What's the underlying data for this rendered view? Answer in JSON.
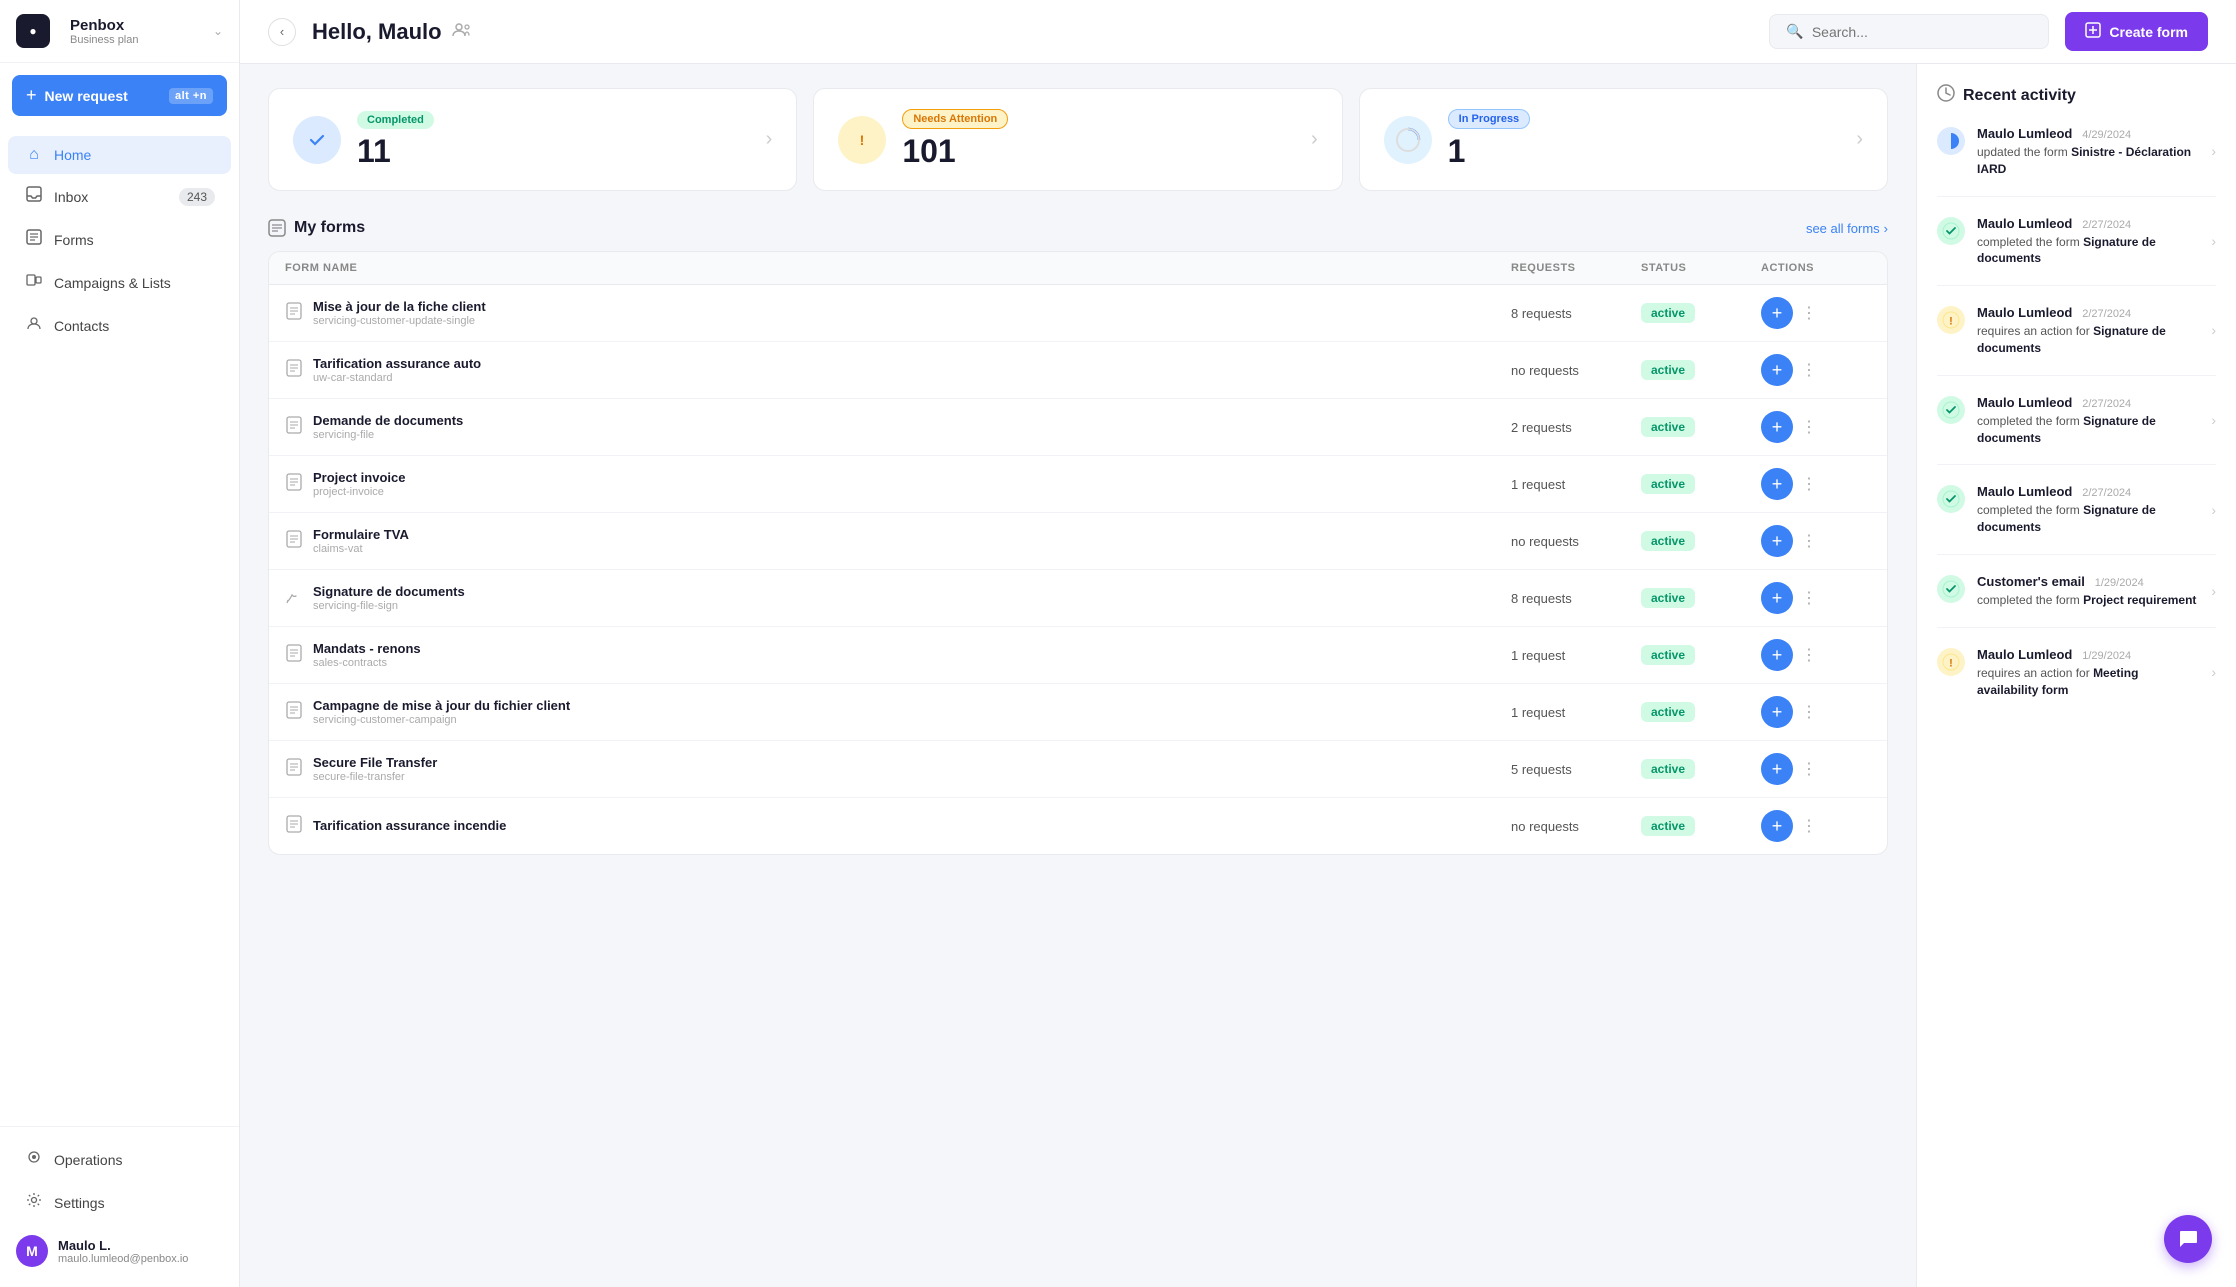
{
  "sidebar": {
    "brand": {
      "name": "Penbox",
      "plan": "Business plan",
      "logo_letter": "●"
    },
    "new_request": {
      "label": "New request",
      "badge": "alt +n"
    },
    "nav_items": [
      {
        "id": "home",
        "label": "Home",
        "icon": "⌂",
        "active": true
      },
      {
        "id": "inbox",
        "label": "Inbox",
        "icon": "□",
        "badge": "243"
      },
      {
        "id": "forms",
        "label": "Forms",
        "icon": "≡",
        "active": false
      },
      {
        "id": "campaigns",
        "label": "Campaigns & Lists",
        "icon": "⊞",
        "active": false
      },
      {
        "id": "contacts",
        "label": "Contacts",
        "icon": "👤",
        "active": false
      }
    ],
    "bottom_items": [
      {
        "id": "operations",
        "label": "Operations",
        "icon": "⚙"
      },
      {
        "id": "settings",
        "label": "Settings",
        "icon": "⚙"
      }
    ],
    "user": {
      "name": "Maulo L.",
      "email": "maulo.lumleod@penbox.io",
      "avatar_initial": "M"
    }
  },
  "topbar": {
    "title": "Hello, Maulo",
    "search_placeholder": "Search...",
    "create_form_label": "Create form"
  },
  "stats": [
    {
      "id": "completed",
      "badge": "Completed",
      "badge_type": "green",
      "value": "11",
      "icon": "✓",
      "icon_type": "blue"
    },
    {
      "id": "needs_attention",
      "badge": "Needs Attention",
      "badge_type": "yellow",
      "value": "101",
      "icon": "!",
      "icon_type": "yellow"
    },
    {
      "id": "in_progress",
      "badge": "In Progress",
      "badge_type": "blue",
      "value": "1",
      "icon": "◑",
      "icon_type": "gray"
    }
  ],
  "forms_section": {
    "title": "My forms",
    "see_all_label": "see all forms",
    "table_headers": [
      "FORM NAME",
      "REQUESTS",
      "STATUS",
      "ACTIONS"
    ],
    "rows": [
      {
        "title": "Mise à jour de la fiche client",
        "slug": "servicing-customer-update-single",
        "requests": "8 requests",
        "status": "active",
        "icon_type": "doc"
      },
      {
        "title": "Tarification assurance auto",
        "slug": "uw-car-standard",
        "requests": "no requests",
        "status": "active",
        "icon_type": "doc"
      },
      {
        "title": "Demande de documents",
        "slug": "servicing-file",
        "requests": "2 requests",
        "status": "active",
        "icon_type": "doc"
      },
      {
        "title": "Project invoice",
        "slug": "project-invoice",
        "requests": "1 request",
        "status": "active",
        "icon_type": "doc"
      },
      {
        "title": "Formulaire TVA",
        "slug": "claims-vat",
        "requests": "no requests",
        "status": "active",
        "icon_type": "doc"
      },
      {
        "title": "Signature de documents",
        "slug": "servicing-file-sign",
        "requests": "8 requests",
        "status": "active",
        "icon_type": "sign"
      },
      {
        "title": "Mandats - renons",
        "slug": "sales-contracts",
        "requests": "1 request",
        "status": "active",
        "icon_type": "doc"
      },
      {
        "title": "Campagne de mise à jour du fichier client",
        "slug": "servicing-customer-campaign",
        "requests": "1 request",
        "status": "active",
        "icon_type": "doc"
      },
      {
        "title": "Secure File Transfer",
        "slug": "secure-file-transfer",
        "requests": "5 requests",
        "status": "active",
        "icon_type": "doc"
      },
      {
        "title": "Tarification assurance incendie",
        "slug": "",
        "requests": "no requests",
        "status": "active",
        "icon_type": "doc"
      }
    ]
  },
  "activity": {
    "title": "Recent activity",
    "items": [
      {
        "user": "Maulo Lumleod",
        "date": "4/29/2024",
        "text": "updated the form ",
        "bold": "Sinistre - Déclaration IARD",
        "icon_type": "blue-half"
      },
      {
        "user": "Maulo Lumleod",
        "date": "2/27/2024",
        "text": "completed the form ",
        "bold": "Signature de documents",
        "icon_type": "green-check"
      },
      {
        "user": "Maulo Lumleod",
        "date": "2/27/2024",
        "text": "requires an action for ",
        "bold": "Signature de documents",
        "icon_type": "yellow-warn"
      },
      {
        "user": "Maulo Lumleod",
        "date": "2/27/2024",
        "text": "completed the form ",
        "bold": "Signature de documents",
        "icon_type": "green-check"
      },
      {
        "user": "Maulo Lumleod",
        "date": "2/27/2024",
        "text": "completed the form ",
        "bold": "Signature de documents",
        "icon_type": "green-check"
      },
      {
        "user": "Customer's email",
        "date": "1/29/2024",
        "text": "completed the form ",
        "bold": "Project requirement",
        "icon_type": "green-check"
      },
      {
        "user": "Maulo Lumleod",
        "date": "1/29/2024",
        "text": "requires an action for ",
        "bold": "Meeting availability form",
        "icon_type": "yellow-warn"
      }
    ]
  },
  "colors": {
    "primary_blue": "#3b82f6",
    "purple": "#7c3aed",
    "green": "#059669",
    "yellow": "#d97706"
  }
}
